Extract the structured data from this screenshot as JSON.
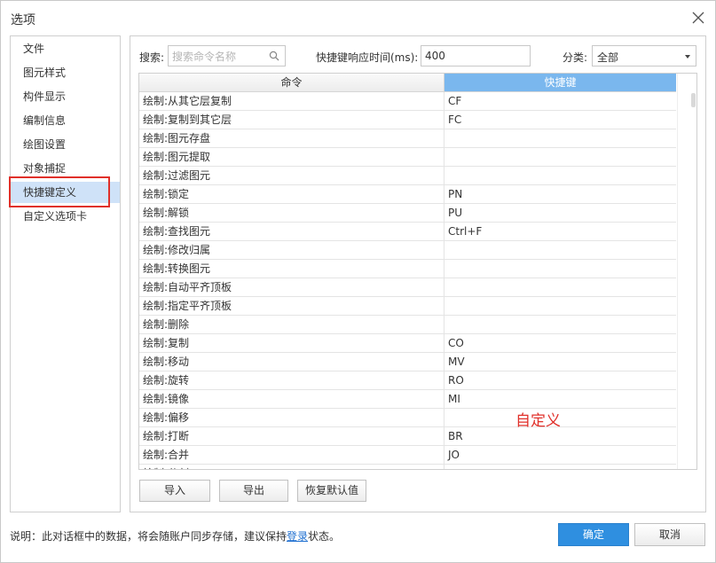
{
  "window": {
    "title": "选项"
  },
  "nav": {
    "items": [
      {
        "label": "文件"
      },
      {
        "label": "图元样式"
      },
      {
        "label": "构件显示"
      },
      {
        "label": "编制信息"
      },
      {
        "label": "绘图设置"
      },
      {
        "label": "对象捕捉"
      },
      {
        "label": "快捷键定义",
        "active": true
      },
      {
        "label": "自定义选项卡"
      }
    ]
  },
  "toolbar": {
    "search_label": "搜索:",
    "search_placeholder": "搜索命令名称",
    "delay_label": "快捷键响应时间(ms):",
    "delay_value": "400",
    "category_label": "分类:",
    "category_value": "全部"
  },
  "table": {
    "headers": {
      "command": "命令",
      "shortcut": "快捷键"
    },
    "rows": [
      {
        "command": "绘制:从其它层复制",
        "shortcut": "CF"
      },
      {
        "command": "绘制:复制到其它层",
        "shortcut": "FC"
      },
      {
        "command": "绘制:图元存盘",
        "shortcut": ""
      },
      {
        "command": "绘制:图元提取",
        "shortcut": ""
      },
      {
        "command": "绘制:过滤图元",
        "shortcut": ""
      },
      {
        "command": "绘制:锁定",
        "shortcut": "PN"
      },
      {
        "command": "绘制:解锁",
        "shortcut": "PU"
      },
      {
        "command": "绘制:查找图元",
        "shortcut": "Ctrl+F"
      },
      {
        "command": "绘制:修改归属",
        "shortcut": ""
      },
      {
        "command": "绘制:转换图元",
        "shortcut": ""
      },
      {
        "command": "绘制:自动平齐顶板",
        "shortcut": ""
      },
      {
        "command": "绘制:指定平齐顶板",
        "shortcut": ""
      },
      {
        "command": "绘制:删除",
        "shortcut": ""
      },
      {
        "command": "绘制:复制",
        "shortcut": "CO"
      },
      {
        "command": "绘制:移动",
        "shortcut": "MV"
      },
      {
        "command": "绘制:旋转",
        "shortcut": "RO"
      },
      {
        "command": "绘制:镜像",
        "shortcut": "MI"
      },
      {
        "command": "绘制:偏移",
        "shortcut": ""
      },
      {
        "command": "绘制:打断",
        "shortcut": "BR"
      },
      {
        "command": "绘制:合并",
        "shortcut": "JO"
      },
      {
        "command": "绘制:分割",
        "shortcut": ""
      }
    ]
  },
  "annotation": "自定义",
  "actions": {
    "import": "导入",
    "export": "导出",
    "restore": "恢复默认值"
  },
  "footer": {
    "note_prefix": "说明：此对话框中的数据，将会随账户同步存储，建议保持",
    "note_link": "登录",
    "note_suffix": "状态。",
    "ok": "确定",
    "cancel": "取消"
  },
  "colors": {
    "accent": "#2f8fe0",
    "header_active": "#7ab7ee",
    "nav_active": "#cfe2f8",
    "highlight": "#e0302a"
  }
}
